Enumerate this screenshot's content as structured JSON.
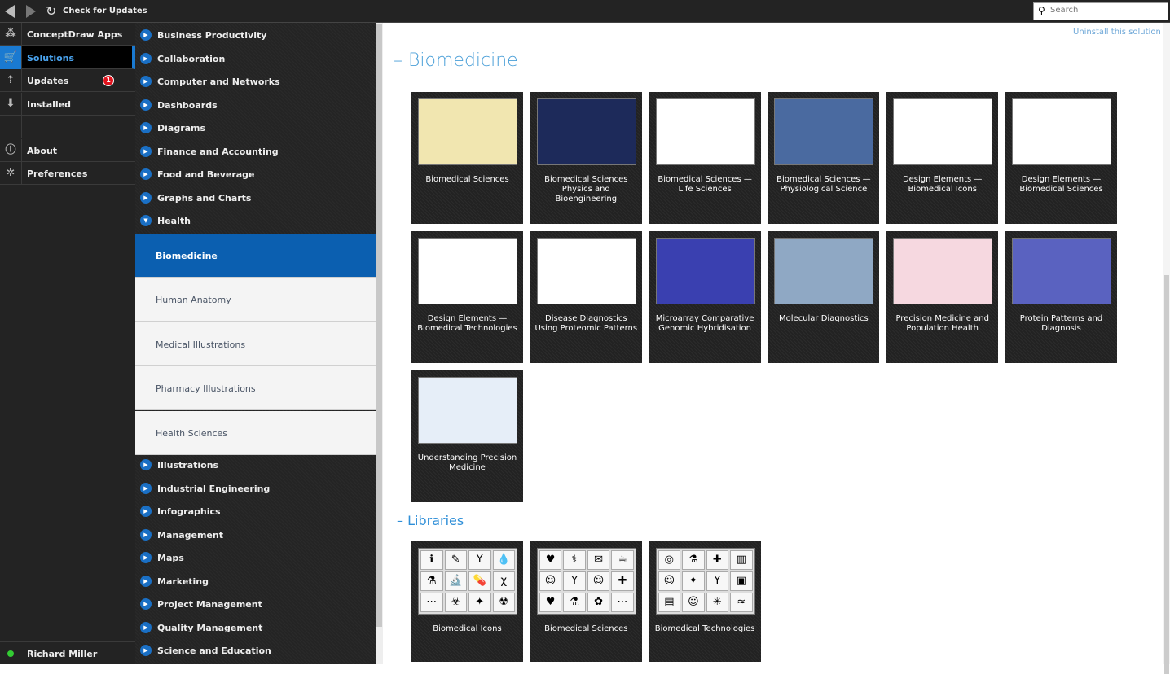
{
  "topbar": {
    "check_updates": "Check for Updates",
    "search_placeholder": "Search"
  },
  "left_nav": [
    {
      "label": "ConceptDraw Apps",
      "icon": "apps-icon"
    },
    {
      "label": "Solutions",
      "icon": "cart-icon",
      "selected": true
    },
    {
      "label": "Updates",
      "icon": "updates-icon",
      "badge": "1"
    },
    {
      "label": "Installed",
      "icon": "download-icon"
    },
    {
      "label": "",
      "icon": ""
    },
    {
      "label": "About",
      "icon": "info-icon"
    },
    {
      "label": "Preferences",
      "icon": "gear-icon"
    }
  ],
  "user": {
    "name": "Richard Miller",
    "status_color": "#33cc33"
  },
  "categories_top": [
    "Business Productivity",
    "Collaboration",
    "Computer and Networks",
    "Dashboards",
    "Diagrams",
    "Finance and Accounting",
    "Food and Beverage",
    "Graphs and Charts",
    "Health"
  ],
  "health_subs": [
    "Biomedicine",
    "Human Anatomy",
    "Medical Illustrations",
    "Pharmacy Illustrations",
    "Health Sciences"
  ],
  "categories_bottom": [
    "Illustrations",
    "Industrial Engineering",
    "Infographics",
    "Management",
    "Maps",
    "Marketing",
    "Project Management",
    "Quality Management",
    "Science and Education"
  ],
  "main": {
    "uninstall": "Uninstall this solution",
    "title": "Biomedicine",
    "libraries_title": "Libraries",
    "templates": [
      {
        "title": "Biomedical Sciences",
        "bg": "#f1e6b0"
      },
      {
        "title": "Biomedical Sciences Physics and Bioengineering",
        "bg": "#1d2a5a"
      },
      {
        "title": "Biomedical Sciences — Life Sciences",
        "bg": "#ffffff"
      },
      {
        "title": "Biomedical Sciences — Physiological Science",
        "bg": "#4a6aa0"
      },
      {
        "title": "Design Elements — Biomedical Icons",
        "bg": "#ffffff"
      },
      {
        "title": "Design Elements — Biomedical Sciences",
        "bg": "#ffffff"
      },
      {
        "title": "Design Elements — Biomedical Technologies",
        "bg": "#ffffff"
      },
      {
        "title": "Disease Diagnostics Using Proteomic Patterns",
        "bg": "#ffffff"
      },
      {
        "title": "Microarray Comparative Genomic Hybridisation",
        "bg": "#3a40b0"
      },
      {
        "title": "Molecular Diagnostics",
        "bg": "#8fa8c4"
      },
      {
        "title": "Precision Medicine and Population Health",
        "bg": "#f6d8e0"
      },
      {
        "title": "Protein Patterns and Diagnosis",
        "bg": "#5a62c0"
      },
      {
        "title": "Understanding Precision Medicine",
        "bg": "#e6eef8"
      }
    ],
    "libraries": [
      {
        "title": "Biomedical Icons",
        "glyphs": [
          "ℹ",
          "✎",
          "Y",
          "💧",
          "⚗",
          "🔬",
          "💊",
          "χ",
          "⋯",
          "☣",
          "✦",
          "☢"
        ]
      },
      {
        "title": "Biomedical Sciences",
        "glyphs": [
          "♥",
          "⚕",
          "✉",
          "☕",
          "☺",
          "Y",
          "☺",
          "✚",
          "♥",
          "⚗",
          "✿",
          "⋯"
        ]
      },
      {
        "title": "Biomedical Technologies",
        "glyphs": [
          "◎",
          "⚗",
          "✚",
          "▥",
          "☺",
          "✦",
          "Y",
          "▣",
          "▤",
          "☺",
          "✳",
          "≈"
        ]
      }
    ]
  }
}
